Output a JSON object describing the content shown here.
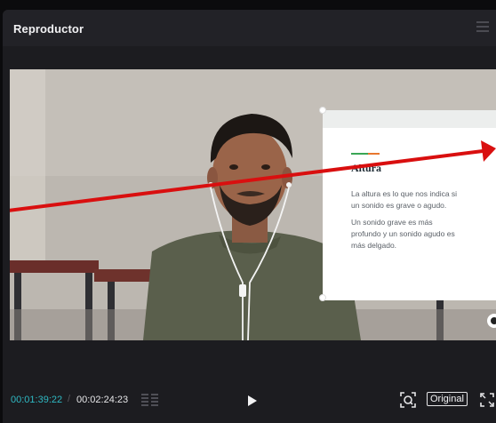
{
  "window": {
    "title": "Reproductor"
  },
  "slide": {
    "heading": "Altura",
    "paragraph1_line1": "La altura es lo que nos indica si",
    "paragraph1_line2": "un sonido es grave o agudo.",
    "paragraph2_line1": "Un sonido grave es más",
    "paragraph2_line2": "profundo y un sonido agudo es",
    "paragraph2_line3": "más delgado."
  },
  "playback": {
    "current_time": "00:01:39:22",
    "separator": "/",
    "total_time": "00:02:24:23"
  },
  "controls": {
    "ratio_label": "Original"
  },
  "colors": {
    "accent": "#2fb9c3",
    "annotation_arrow": "#d90f0f"
  },
  "icons": [
    "menu-icon",
    "chapters-icon",
    "play-icon",
    "focus-icon",
    "fullscreen-icon",
    "record-icon"
  ]
}
